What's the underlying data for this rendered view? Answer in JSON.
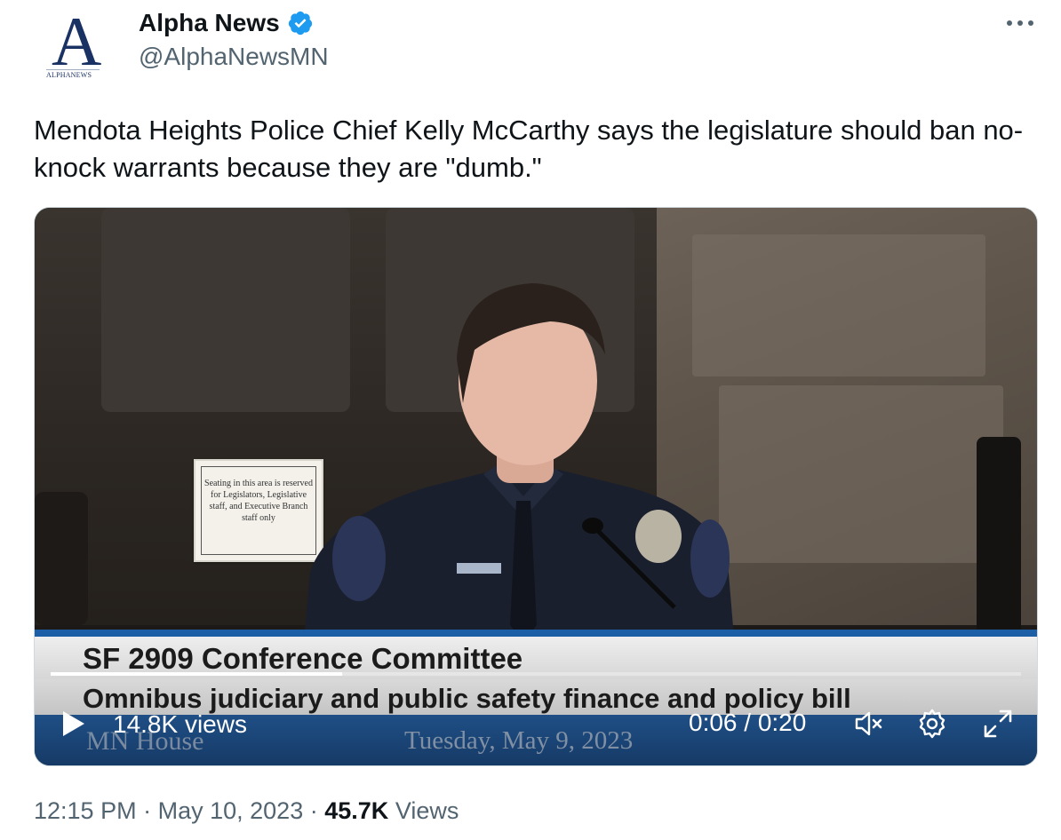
{
  "author": {
    "display_name": "Alpha News",
    "handle": "@AlphaNewsMN",
    "avatar_letter": "A",
    "avatar_caption": "ALPHANEWS",
    "verified": true
  },
  "tweet": {
    "text": "Mendota Heights Police Chief Kelly McCarthy says the legislature should ban no-knock warrants because they are \"dumb.\""
  },
  "video": {
    "sign_text": "Seating in this area is reserved for Legislators, Legislative staff, and Executive Branch staff only",
    "lower_third_title": "SF 2909 Conference Committee",
    "lower_third_subtitle": "Omnibus judiciary and public safety finance and policy bill",
    "watermark_left": "MN House",
    "watermark_date": "Tuesday, May 9, 2023",
    "views_label": "14.8K views",
    "time_label": "0:06 / 0:20",
    "progress_fraction": 0.3
  },
  "footer": {
    "time": "12:15 PM",
    "separator": "·",
    "date": "May 10, 2023",
    "views_count": "45.7K",
    "views_word": "Views"
  },
  "colors": {
    "verified": "#1d9bf0",
    "text": "#0f1419",
    "secondary": "#536471",
    "brand_navy": "#1a3263",
    "lower_third_blue": "#1c5fa7"
  },
  "icons": [
    "verified-badge-icon",
    "more-icon",
    "play-icon",
    "mute-icon",
    "settings-icon",
    "fullscreen-icon"
  ]
}
